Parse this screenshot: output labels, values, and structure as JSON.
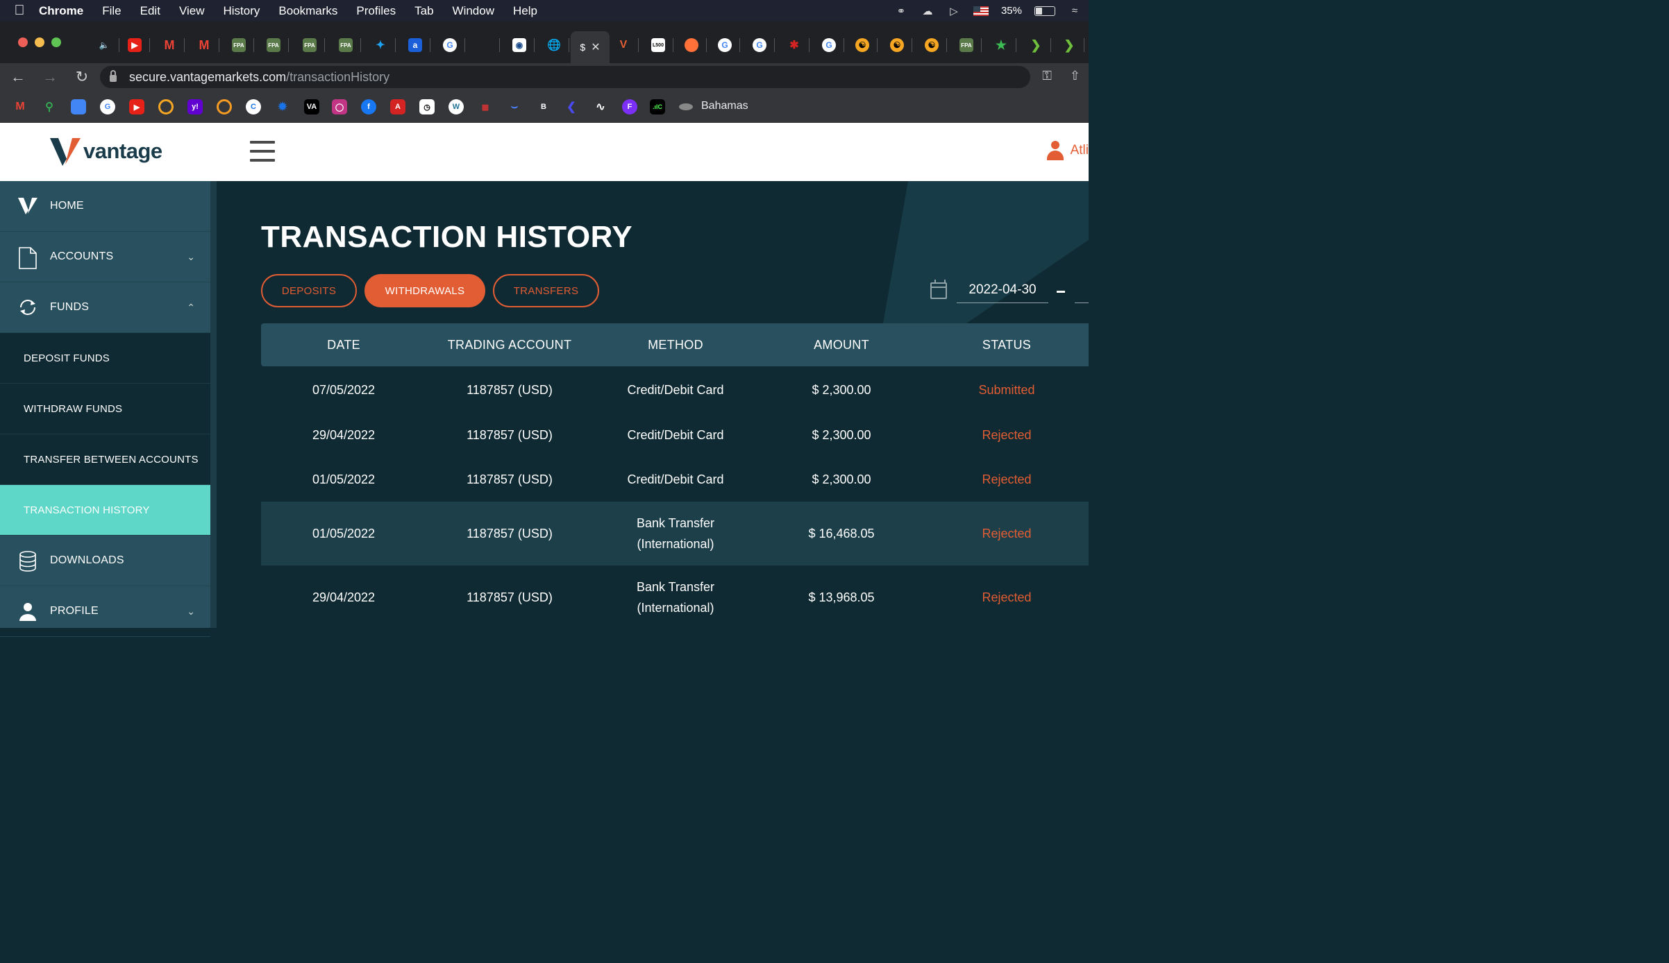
{
  "menubar": {
    "app": "Chrome",
    "items": [
      "File",
      "Edit",
      "View",
      "History",
      "Bookmarks",
      "Profiles",
      "Tab",
      "Window",
      "Help"
    ],
    "battery_percent": "35%",
    "battery_level": 0.35
  },
  "browser": {
    "url_host": "secure.vantagemarkets.com",
    "url_path": "/transactionHistory",
    "active_tab_label": "$",
    "bookmark_label": "Bahamas"
  },
  "site": {
    "brand": "vantage",
    "user_name": "Atli"
  },
  "sidebar": {
    "items": [
      {
        "label": "HOME"
      },
      {
        "label": "ACCOUNTS"
      },
      {
        "label": "FUNDS"
      },
      {
        "label": "DEPOSIT FUNDS"
      },
      {
        "label": "WITHDRAW FUNDS"
      },
      {
        "label": "TRANSFER BETWEEN ACCOUNTS"
      },
      {
        "label": "TRANSACTION HISTORY"
      },
      {
        "label": "DOWNLOADS"
      },
      {
        "label": "PROFILE"
      }
    ]
  },
  "main": {
    "title": "TRANSACTION HISTORY",
    "tabs": [
      {
        "label": "DEPOSITS"
      },
      {
        "label": "WITHDRAWALS"
      },
      {
        "label": "TRANSFERS"
      }
    ],
    "date_from": "2022-04-30",
    "columns": [
      "DATE",
      "TRADING ACCOUNT",
      "METHOD",
      "AMOUNT",
      "STATUS"
    ],
    "rows": [
      {
        "date": "07/05/2022",
        "account": "1187857 (USD)",
        "method": "Credit/Debit Card",
        "method2": "",
        "amount": "$ 2,300.00",
        "status": "Submitted"
      },
      {
        "date": "29/04/2022",
        "account": "1187857 (USD)",
        "method": "Credit/Debit Card",
        "method2": "",
        "amount": "$ 2,300.00",
        "status": "Rejected"
      },
      {
        "date": "01/05/2022",
        "account": "1187857 (USD)",
        "method": "Credit/Debit Card",
        "method2": "",
        "amount": "$ 2,300.00",
        "status": "Rejected"
      },
      {
        "date": "01/05/2022",
        "account": "1187857 (USD)",
        "method": "Bank Transfer",
        "method2": "(International)",
        "amount": "$ 16,468.05",
        "status": "Rejected"
      },
      {
        "date": "29/04/2022",
        "account": "1187857 (USD)",
        "method": "Bank Transfer",
        "method2": "(International)",
        "amount": "$ 13,968.05",
        "status": "Rejected"
      }
    ]
  },
  "colors": {
    "accent": "#e25d33",
    "sidebar": "#28505e",
    "active_nav": "#5ed7c9",
    "background": "#0f2a33"
  }
}
